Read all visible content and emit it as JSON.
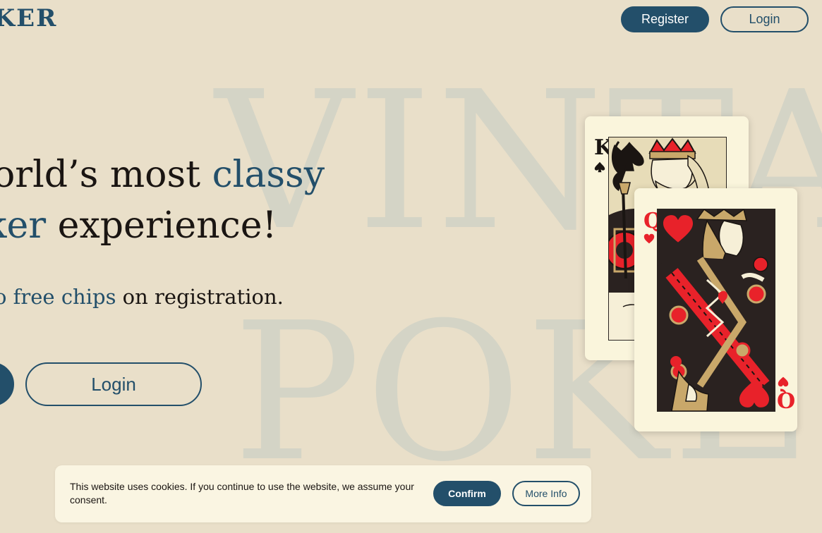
{
  "header": {
    "logo_text": "OKER",
    "register_label": "Register",
    "login_label": "Login"
  },
  "background": {
    "word_top": "VINTAG",
    "word_bottom": "POKER"
  },
  "hero": {
    "line1_a": "orld’s most ",
    "line1_accent": "classy",
    "line2_accent": "ker",
    "line2_b": " experience!",
    "sub_accent": "o free chips",
    "sub_b": " on registration.",
    "login_label": "Login"
  },
  "cards": {
    "king_rank": "K",
    "queen_rank": "Q"
  },
  "cookie": {
    "message": "This website uses cookies. If you continue to use the website, we assume your consent.",
    "confirm_label": "Confirm",
    "more_label": "More Info"
  },
  "colors": {
    "background": "#e9dfc9",
    "accent": "#234f6a",
    "card": "#faf5dc",
    "heart": "#e8222a"
  }
}
